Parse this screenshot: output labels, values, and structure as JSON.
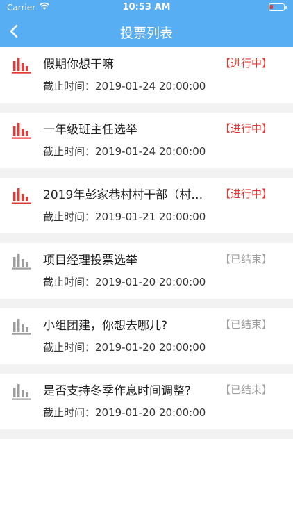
{
  "status_bar": {
    "carrier": "Carrier",
    "time": "10:53 AM"
  },
  "nav": {
    "title": "投票列表"
  },
  "colors": {
    "header": "#57aef3",
    "active": "#e53935",
    "ended": "#9e9e9e"
  },
  "deadline_label": "截止时间：",
  "items": [
    {
      "title": "假期你想干嘛",
      "status": "【进行中】",
      "state": "active",
      "deadline": "截止时间：2019-01-24 20:00:00"
    },
    {
      "title": "一年级班主任选举",
      "status": "【进行中】",
      "state": "active",
      "deadline": "截止时间：2019-01-24 20:00:00"
    },
    {
      "title": "2019年彭家巷村村干部（村…",
      "status": "【进行中】",
      "state": "active",
      "deadline": "截止时间：2019-01-21 20:00:00"
    },
    {
      "title": "项目经理投票选举",
      "status": "【已结束】",
      "state": "ended",
      "deadline": "截止时间：2019-01-20 20:00:00"
    },
    {
      "title": "小组团建，你想去哪儿?",
      "status": "【已结束】",
      "state": "ended",
      "deadline": "截止时间：2019-01-20 20:00:00"
    },
    {
      "title": "是否支持冬季作息时间调整?",
      "status": "【已结束】",
      "state": "ended",
      "deadline": "截止时间：2019-01-20 20:00:00"
    }
  ]
}
